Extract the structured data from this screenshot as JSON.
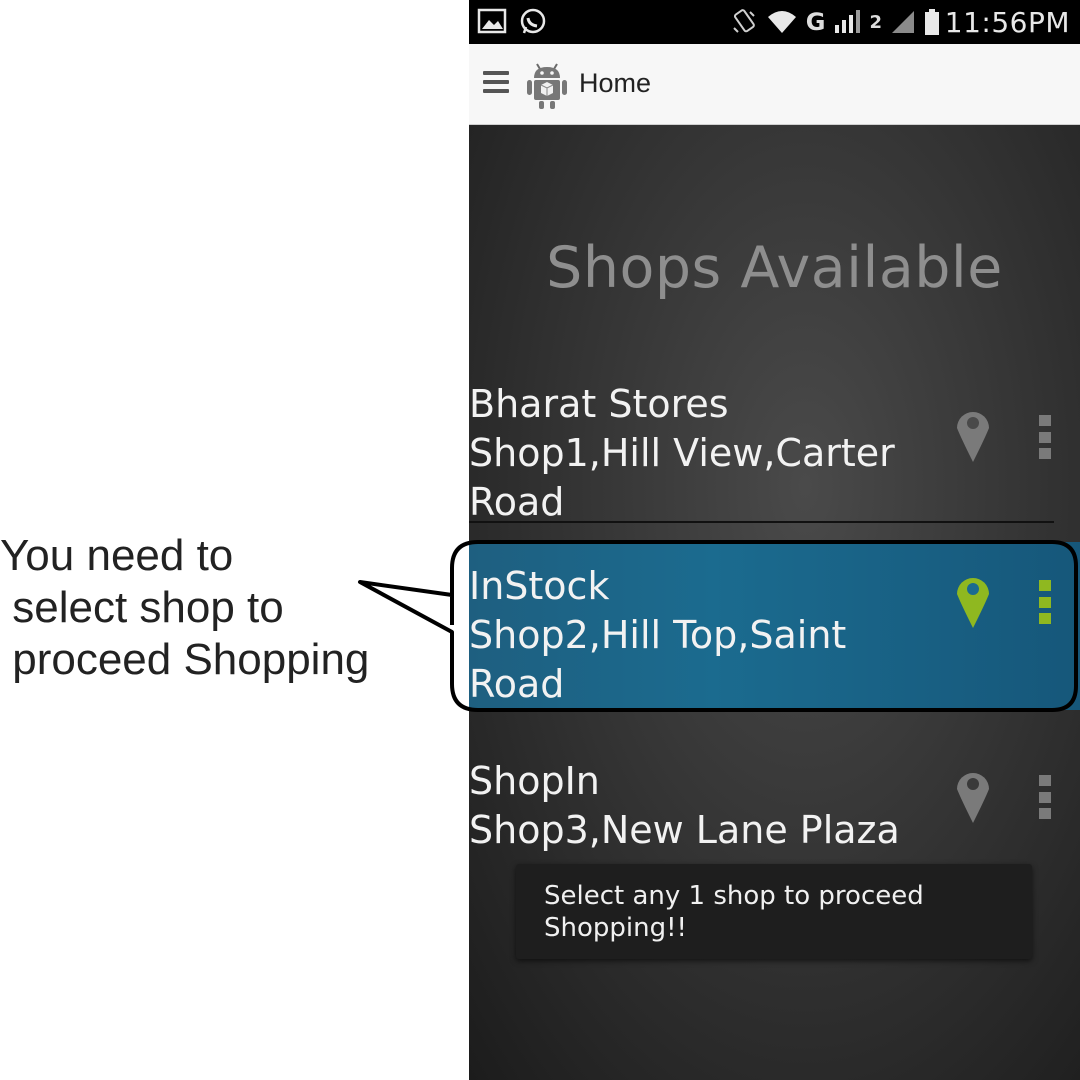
{
  "callout": {
    "lines": [
      "You need to",
      " select shop to",
      " proceed Shopping"
    ]
  },
  "status_bar": {
    "time": "11:56PM",
    "network_label": "G",
    "sim2_label": "2",
    "icons": [
      "gallery-icon",
      "whatsapp-icon",
      "vibrate-icon",
      "wifi-icon",
      "signal-icon",
      "battery-icon"
    ]
  },
  "action_bar": {
    "title": "Home",
    "menu_icon": "hamburger-icon",
    "app_icon": "android-logo-icon"
  },
  "content": {
    "heading": "Shops Available"
  },
  "shops": [
    {
      "name": "Bharat Stores",
      "address_line1": "Shop1,Hill View,Carter",
      "address_line2": "Road",
      "selected": false
    },
    {
      "name": "InStock",
      "address_line1": "Shop2,Hill Top,Saint",
      "address_line2": "Road",
      "selected": true
    },
    {
      "name": "ShopIn",
      "address_line1": "Shop3,New Lane Plaza",
      "address_line2": "",
      "selected": false
    }
  ],
  "toast": {
    "line1": "Select any 1 shop to proceed",
    "line2": "Shopping!!"
  },
  "colors": {
    "selected_row": "#1b6b8f",
    "selected_icon": "#8fb820",
    "unselected_icon": "#7a7a7a",
    "heading_text": "#8e8e8e"
  }
}
